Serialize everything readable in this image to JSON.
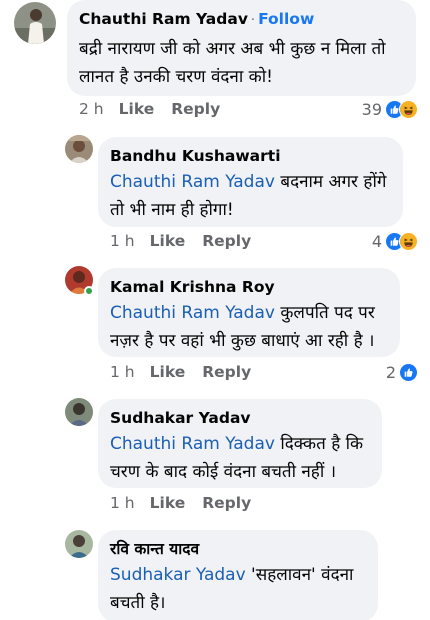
{
  "comments": [
    {
      "author": "Chauthi Ram Yadav",
      "separator": "·",
      "follow_label": "Follow",
      "line1": "बद्री नारायण जी को अगर अब भी कुछ न मिला तो",
      "line2": "लानत है उनकी चरण वंदना को!",
      "time": "2 h",
      "like": "Like",
      "reply": "Reply",
      "reaction_count": "39",
      "reactions": [
        "like-icon",
        "haha-icon"
      ]
    },
    {
      "author": "Bandhu Kushawarti",
      "mention": "Chauthi Ram Yadav",
      "line1_rest": " बदनाम अगर होंगे",
      "line2": "तो भी नाम ही होगा!",
      "time": "1 h",
      "like": "Like",
      "reply": "Reply",
      "reaction_count": "4",
      "reactions": [
        "like-icon",
        "haha-icon"
      ]
    },
    {
      "author": "Kamal Krishna Roy",
      "mention": "Chauthi Ram Yadav",
      "line1_rest": " कुलपति पद पर",
      "line2": "नज़र है पर वहां भी कुछ बाधाएं आ रही है ।",
      "time": "1 h",
      "like": "Like",
      "reply": "Reply",
      "reaction_count": "2",
      "reactions": [
        "like-icon"
      ]
    },
    {
      "author": "Sudhakar Yadav",
      "mention": "Chauthi Ram Yadav",
      "line1_rest": " दिक्कत है कि",
      "line2": "चरण के बाद कोई वंदना बचती नहीं ।",
      "time": "1 h",
      "like": "Like",
      "reply": "Reply"
    },
    {
      "author": "रवि कान्त यादव",
      "mention": "Sudhakar Yadav",
      "line1_rest": " 'सहलावन'  वंदना",
      "line2": "बचती है।"
    }
  ],
  "colors": {
    "bubble": "#f0f2f5",
    "link": "#1877f2",
    "mention": "#1a5fb4",
    "meta": "#65676b",
    "like_blue": "#1877f2",
    "haha_yellow": "#f7b125",
    "online": "#31a24c"
  }
}
